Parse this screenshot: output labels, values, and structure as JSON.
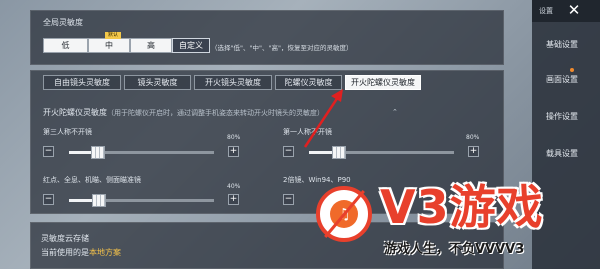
{
  "global": {
    "title": "全局灵敏度",
    "options": [
      "低",
      "中",
      "高",
      "自定义"
    ],
    "selected_index": 3,
    "badge": "默认",
    "note": "（选择\"低\"、\"中\"、\"高\"，恢复至对应的灵敏度）"
  },
  "tabs": {
    "items": [
      "自由镜头灵敏度",
      "镜头灵敏度",
      "开火镜头灵敏度",
      "陀螺仪灵敏度",
      "开火陀螺仪灵敏度"
    ],
    "selected_index": 4
  },
  "gyro": {
    "title": "开火陀螺仪灵敏度",
    "desc": "（用于陀螺仪开启时，通过调整手机姿态来转动开火时镜头的灵敏度）",
    "chevron": "⌃",
    "sliders": [
      {
        "label": "第三人称不开镜",
        "percent_label": "80%",
        "value": 0.2
      },
      {
        "label": "第一人称不开镜",
        "percent_label": "80%",
        "value": 0.21
      },
      {
        "label": "红点、全息、机瞄、侧面瞄准镜",
        "percent_label": "40%",
        "value": 0.21
      },
      {
        "label": "2倍镜、Win94、P90",
        "percent_label": "",
        "value": 0.0
      }
    ]
  },
  "cloud": {
    "title": "灵敏度云存储",
    "current_prefix": "当前使用的是",
    "current_value": "本地方案"
  },
  "sidebar": {
    "top_label": "设置",
    "close_glyph": "✕",
    "items": [
      "基础设置",
      "画面设置",
      "操作设置",
      "载具设置"
    ]
  },
  "watermark": {
    "brand": "V3游戏",
    "slogan": "游戏人生，不负VVVV3",
    "logo_glyph": "♫"
  },
  "colors": {
    "accent": "#e8402c",
    "highlight": "#f5c24a",
    "panel": "#282e38"
  }
}
